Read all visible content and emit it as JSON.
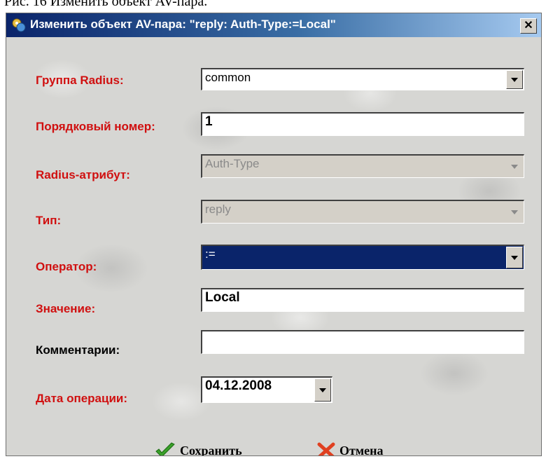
{
  "document": {
    "caption": "Рис. 16 Изменить объект AV-пара."
  },
  "window": {
    "title": "Изменить объект AV-пара: \"reply: Auth-Type:=Local\"",
    "close_label": "✕"
  },
  "form": {
    "radius_group": {
      "label": "Группа Radius:",
      "value": "common"
    },
    "order_number": {
      "label": "Порядковый номер:",
      "value": "1"
    },
    "radius_attribute": {
      "label": "Radius-атрибут:",
      "value": "Auth-Type"
    },
    "type": {
      "label": "Тип:",
      "value": "reply"
    },
    "operator": {
      "label": "Оператор:",
      "value": ":="
    },
    "value": {
      "label": "Значение:",
      "value": "Local"
    },
    "comments": {
      "label": "Комментарии:",
      "value": ""
    },
    "operation_date": {
      "label": "Дата операции:",
      "value": "04.12.2008"
    }
  },
  "buttons": {
    "save": {
      "label": "Сохранить",
      "icon": "checkmark-icon",
      "color": "#3aa02a"
    },
    "cancel": {
      "label": "Отмена",
      "icon": "cross-icon",
      "color": "#e04020"
    }
  },
  "colors": {
    "label_required": "#d01010",
    "selection": "#0a246a",
    "title_gradient_start": "#0a246a",
    "title_gradient_end": "#a6caf0"
  }
}
